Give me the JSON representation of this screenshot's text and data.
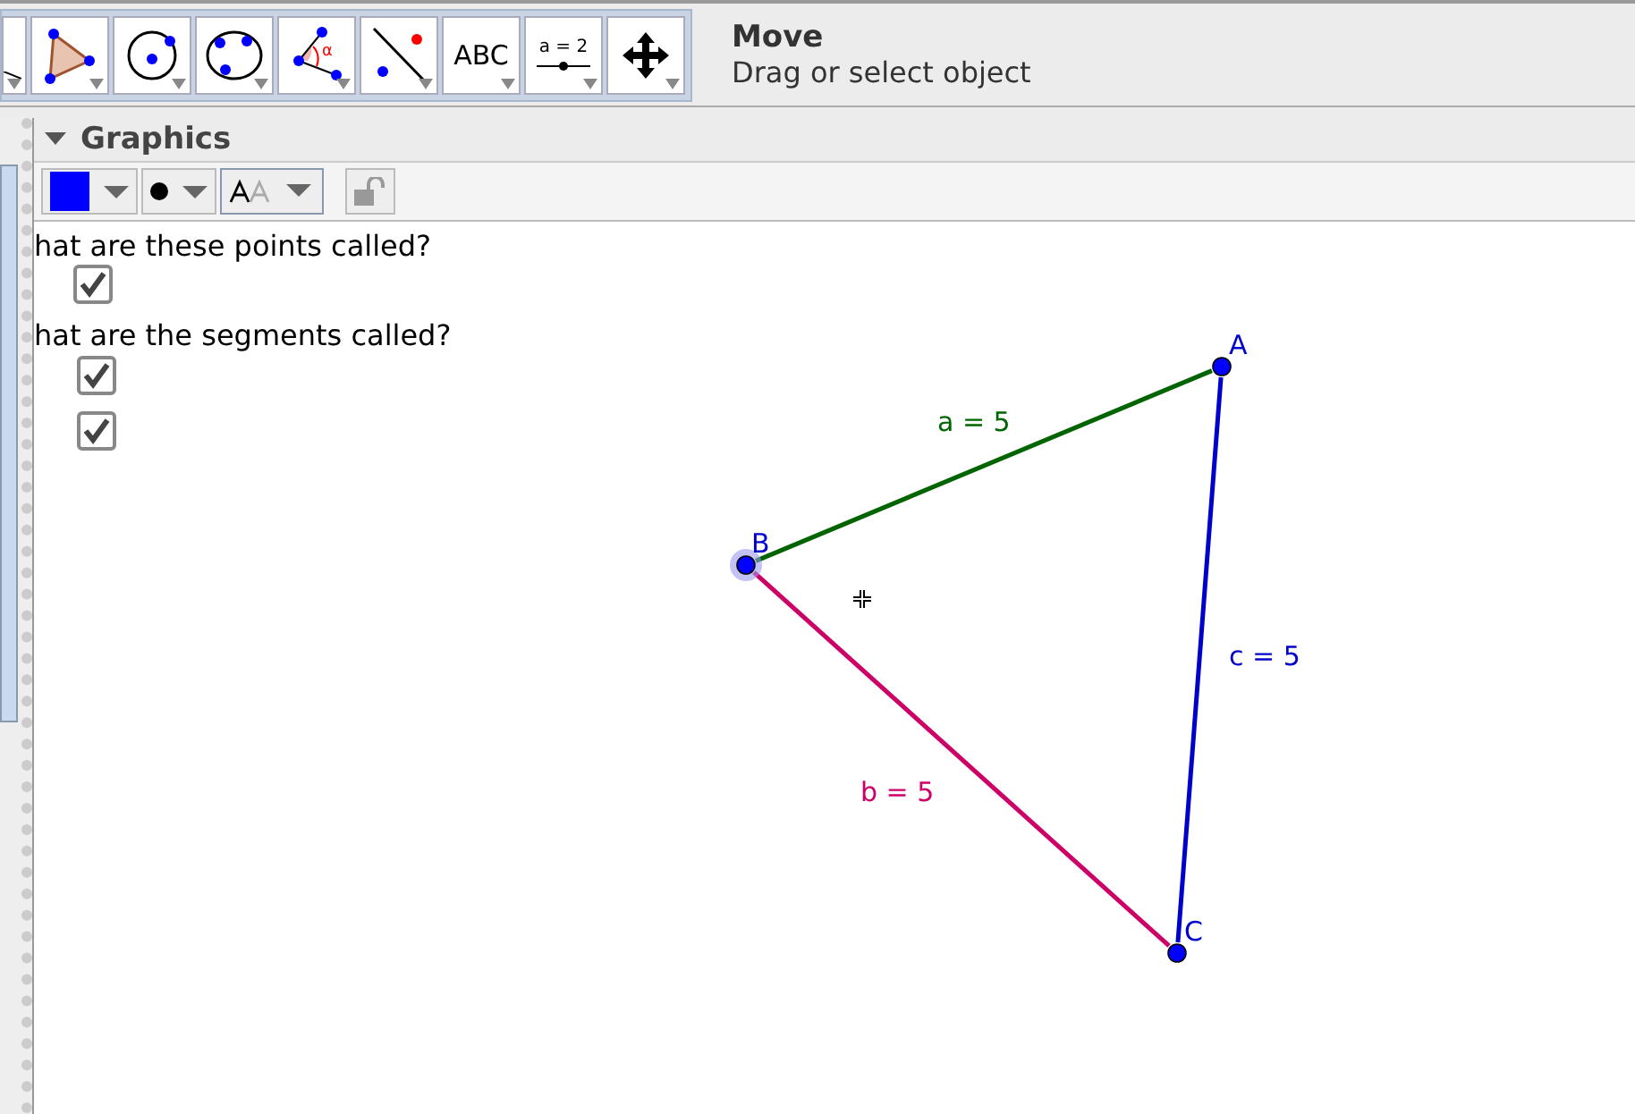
{
  "toolbar": {
    "tools": [
      {
        "kind": "partial"
      },
      {
        "kind": "polygon"
      },
      {
        "kind": "circle-center"
      },
      {
        "kind": "circle-three"
      },
      {
        "kind": "angle",
        "label": "α"
      },
      {
        "kind": "reflect"
      },
      {
        "kind": "text",
        "label": "ABC"
      },
      {
        "kind": "slider",
        "label": "a = 2"
      },
      {
        "kind": "move"
      }
    ],
    "tool_name": "Move",
    "tool_hint": "Drag or select object"
  },
  "graphics": {
    "title": "Graphics",
    "style_bar": {
      "color": "#0000ff"
    },
    "questions": [
      {
        "text": "hat are these points called?"
      },
      {
        "text": "hat are the segments called?"
      }
    ],
    "checkboxes": [
      {
        "checked": true
      },
      {
        "checked": true
      },
      {
        "checked": true
      }
    ],
    "points": [
      {
        "label": "A",
        "selected": false
      },
      {
        "label": "B",
        "selected": true
      },
      {
        "label": "C",
        "selected": false
      }
    ],
    "segments": [
      {
        "label": "a = 5",
        "color": "#006400"
      },
      {
        "label": "b = 5",
        "color": "#cc0066"
      },
      {
        "label": "c = 5",
        "color": "#0000cc"
      }
    ]
  }
}
